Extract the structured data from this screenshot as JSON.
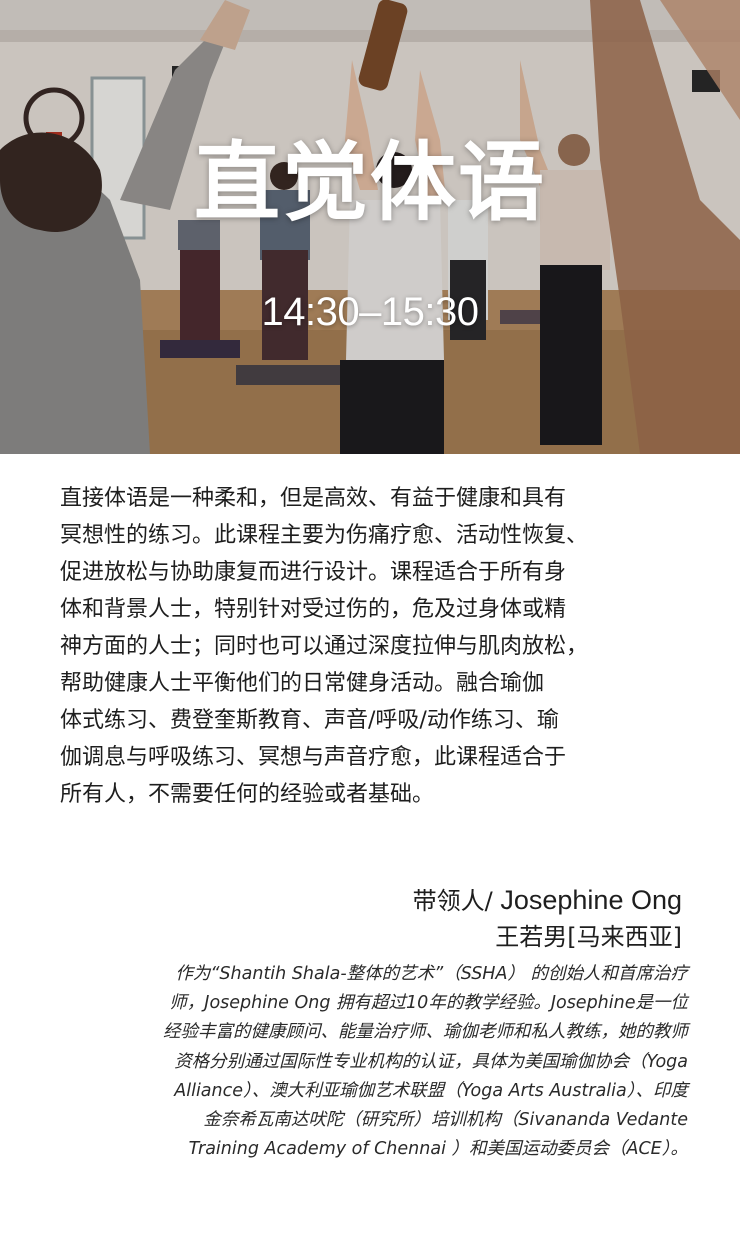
{
  "hero": {
    "title": "直觉体语",
    "time": "14:30–15:30"
  },
  "description": {
    "lines": [
      "直接体语是一种柔和，但是高效、有益于健康和具有",
      "冥想性的练习。此课程主要为伤痛疗愈、活动性恢复、",
      "促进放松与协助康复而进行设计。课程适合于所有身",
      "体和背景人士，特别针对受过伤的，危及过身体或精",
      "神方面的人士；同时也可以通过深度拉伸与肌肉放松，",
      "帮助健康人士平衡他们的日常健身活动。融合瑜伽",
      "体式练习、费登奎斯教育、声音/呼吸/动作练习、瑜",
      "伽调息与呼吸练习、冥想与声音疗愈，此课程适合于",
      "所有人，不需要任何的经验或者基础。"
    ]
  },
  "leader": {
    "role_label": "带领人/ ",
    "name_en": "Josephine Ong",
    "name_cn": "王若男[马来西亚]"
  },
  "bio": {
    "lines": [
      "作为“Shantih Shala-整体的艺术”（SSHA） 的创始人和首席治疗",
      "师，Josephine Ong 拥有超过10年的教学经验。Josephine是一位",
      "经验丰富的健康顾问、能量治疗师、瑜伽老师和私人教练，她的教师",
      "资格分别通过国际性专业机构的认证，具体为美国瑜伽协会（Yoga",
      "Alliance）、澳大利亚瑜伽艺术联盟（Yoga Arts Australia）、印度",
      "金奈希瓦南达吠陀（研究所）培训机构（Sivananda Vedante",
      "Training Academy of Chennai ）和美国运动委员会（ACE）。"
    ]
  },
  "colors": {
    "text": "#1e1e1e",
    "hero_overlay_text": "#ffffff"
  }
}
